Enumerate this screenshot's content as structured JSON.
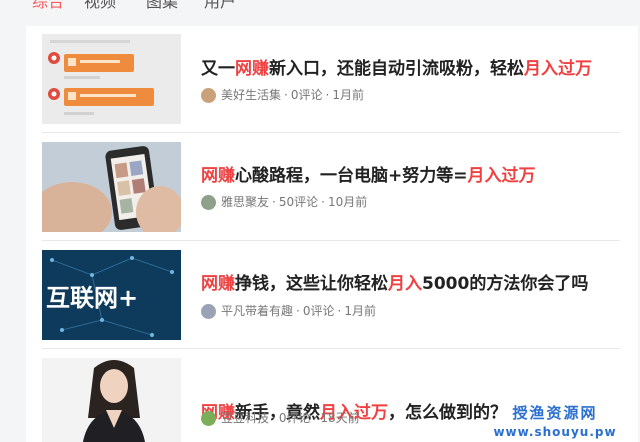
{
  "tabs": [
    "综合",
    "视频",
    "图集",
    "用户"
  ],
  "articles": [
    {
      "title_parts": [
        {
          "text": "又一",
          "hl": false
        },
        {
          "text": "网赚",
          "hl": true
        },
        {
          "text": "新入口，还能自动引流吸粉，轻松",
          "hl": false
        },
        {
          "text": "月入过万",
          "hl": true
        }
      ],
      "author": "美好生活集",
      "comments": "0评论",
      "time": "1月前"
    },
    {
      "title_parts": [
        {
          "text": "网赚",
          "hl": true
        },
        {
          "text": "心酸路程，一台电脑+努力等=",
          "hl": false
        },
        {
          "text": "月入过万",
          "hl": true
        }
      ],
      "author": "雅思聚友",
      "comments": "50评论",
      "time": "10月前"
    },
    {
      "title_parts": [
        {
          "text": "网赚",
          "hl": true
        },
        {
          "text": "挣钱，这些让你轻松",
          "hl": false
        },
        {
          "text": "月入",
          "hl": true
        },
        {
          "text": "5000的方法你会了吗",
          "hl": false
        }
      ],
      "author": "平凡带着有趣",
      "comments": "0评论",
      "time": "1月前",
      "thumb_text": "互联网+"
    },
    {
      "title_parts": [
        {
          "text": "网赚",
          "hl": true
        },
        {
          "text": "新手，竟然",
          "hl": false
        },
        {
          "text": "月入过万",
          "hl": true
        },
        {
          "text": "，怎么做到的？",
          "hl": false
        }
      ],
      "author": "豆豆科技",
      "comments": "0评论",
      "time": "18天前"
    }
  ],
  "meta_separator": "·",
  "watermark": {
    "line1": "授渔资源网",
    "line2": "www.shouyu.pw"
  },
  "colors": {
    "accent": "#f85959",
    "highlight": "#f04142",
    "watermark": "#2a6fd0"
  }
}
